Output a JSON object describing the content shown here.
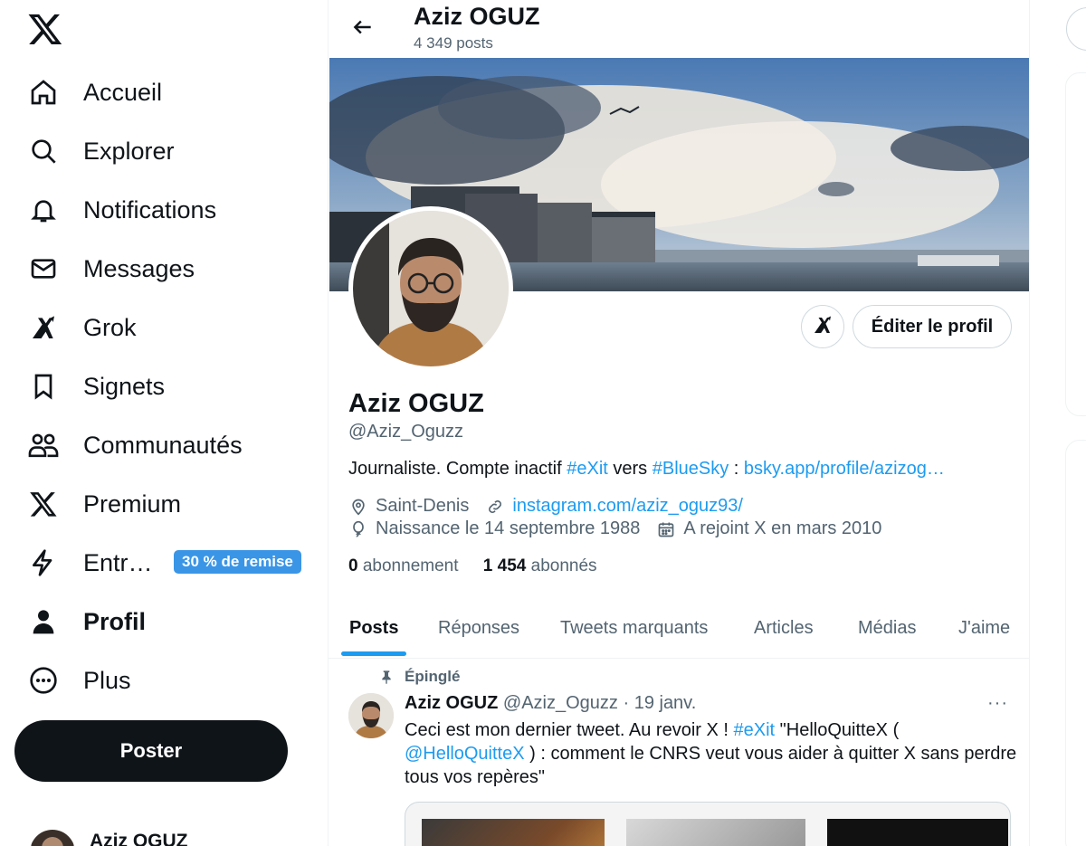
{
  "nav": {
    "items": [
      {
        "label": "Accueil",
        "icon": "home-icon"
      },
      {
        "label": "Explorer",
        "icon": "search-icon"
      },
      {
        "label": "Notifications",
        "icon": "bell-icon"
      },
      {
        "label": "Messages",
        "icon": "mail-icon"
      },
      {
        "label": "Grok",
        "icon": "grok-icon"
      },
      {
        "label": "Signets",
        "icon": "bookmark-icon"
      },
      {
        "label": "Communautés",
        "icon": "communities-icon"
      },
      {
        "label": "Premium",
        "icon": "x-premium-icon"
      },
      {
        "label": "Entr…",
        "icon": "lightning-icon",
        "badge": "30 % de remise"
      },
      {
        "label": "Profil",
        "icon": "person-icon",
        "active": true
      },
      {
        "label": "Plus",
        "icon": "more-circle-icon"
      }
    ],
    "post_button": "Poster",
    "account_name": "Aziz OGUZ"
  },
  "header": {
    "name": "Aziz OGUZ",
    "post_count": "4 349 posts"
  },
  "profile": {
    "edit_button": "Éditer le profil",
    "name": "Aziz OGUZ",
    "handle": "@Aziz_Oguzz",
    "bio": {
      "part1": "Journaliste. Compte inactif ",
      "hashtag1": "#eXit",
      "part2": " vers ",
      "hashtag2": "#BlueSky",
      "part3": " : ",
      "link": "bsky.app/profile/azizog…"
    },
    "location": "Saint-Denis",
    "website": "instagram.com/aziz_oguz93/",
    "birthday": "Naissance le 14 septembre 1988",
    "joined": "A rejoint X en mars 2010",
    "following_count": "0",
    "following_label": "abonnement",
    "followers_count": "1 454",
    "followers_label": "abonnés"
  },
  "tabs": [
    "Posts",
    "Réponses",
    "Tweets marquants",
    "Articles",
    "Médias",
    "J'aime"
  ],
  "tweet": {
    "pinned_label": "Épinglé",
    "author": "Aziz OGUZ",
    "handle_date": "@Aziz_Oguzz · 19 janv.",
    "more": "···",
    "text_part1": "Ceci est mon dernier tweet. Au revoir X ! ",
    "hashtag": "#eXit",
    "text_part2": " \"HelloQuitteX (",
    "mention": "@HelloQuitteX",
    "text_part3": " ) : comment le CNRS veut vous aider à quitter X sans perdre tous vos repères\""
  },
  "colors": {
    "accent": "#1d9bf0",
    "badge": "#3a95e6",
    "text": "#0f1419",
    "muted": "#536471"
  }
}
